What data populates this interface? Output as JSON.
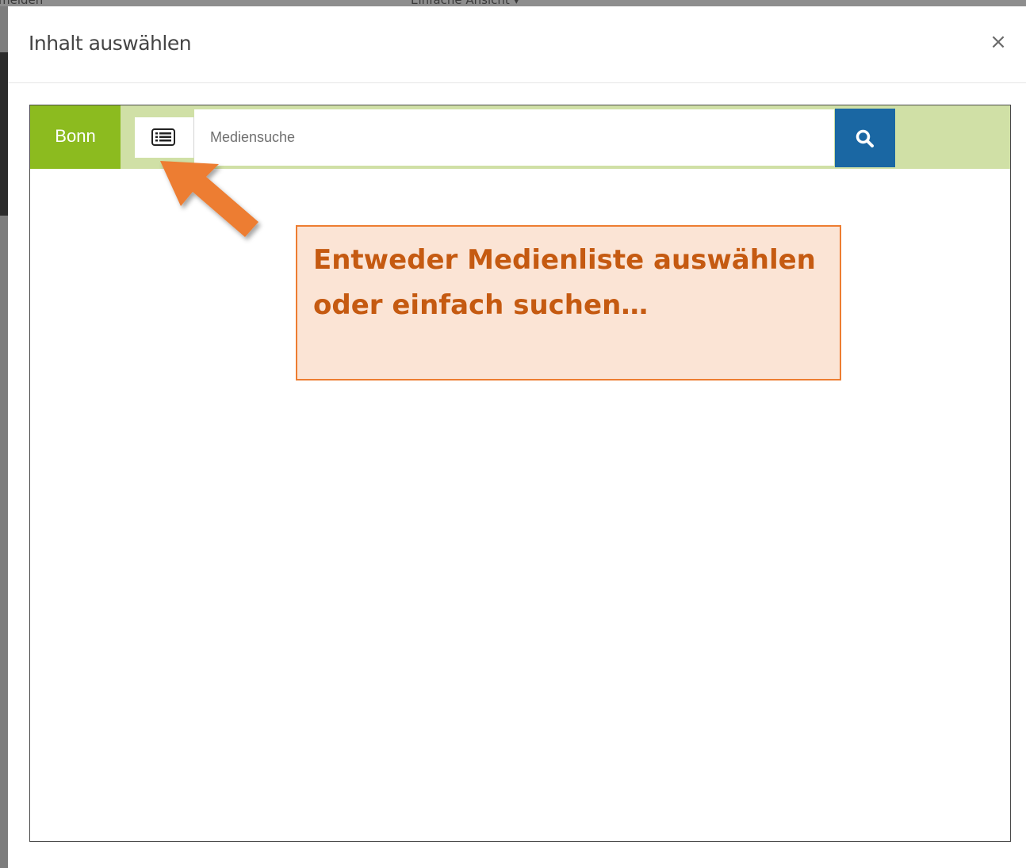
{
  "background": {
    "left_text": "melden",
    "center_text": "Einfache Ansicht ▾"
  },
  "modal": {
    "title": "Inhalt auswählen",
    "close_label": "×"
  },
  "search_bar": {
    "location_label": "Bonn",
    "list_icon": "list-icon",
    "placeholder": "Mediensuche",
    "search_icon": "search-icon"
  },
  "annotation": {
    "text": "Entweder Medienliste auswählen oder einfach suchen…",
    "arrow_icon": "arrow-icon"
  },
  "colors": {
    "location_green": "#8cbb1f",
    "bar_green": "#d0e0a6",
    "search_blue": "#1a67a3",
    "callout_fill": "#fbe4d5",
    "callout_border": "#ed7d31",
    "callout_text": "#c55a11"
  }
}
